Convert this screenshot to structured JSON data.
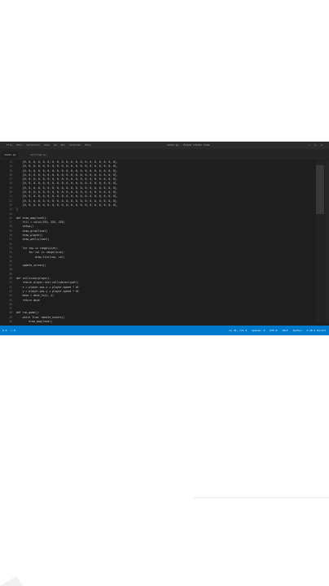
{
  "window": {
    "menu": [
      "File",
      "Edit",
      "Selection",
      "View",
      "Go",
      "Run",
      "Terminal",
      "Help"
    ],
    "title": "level.py - Visual Studio Code",
    "controls": [
      "—",
      "□",
      "✕"
    ]
  },
  "tabs": [
    {
      "label": "level.py"
    },
    {
      "label": "settings.py"
    }
  ],
  "code_lines": [
    {
      "n": "13",
      "t": "    [0, 0, 0, 0, 0, 0, 0, 0, 0, 0, 0, 0, 0, 0, 0, 0, 0, 0, 0, 0],"
    },
    {
      "n": "14",
      "t": "    [0, 0, 0, 0, 0, 0, 0, 0, 0, 0, 0, 0, 0, 0, 0, 0, 0, 0, 0, 0],"
    },
    {
      "n": "15",
      "t": "    [0, 0, 0, 0, 0, 0, 0, 0, 0, 0, 0, 0, 0, 0, 0, 0, 0, 0, 0, 0],"
    },
    {
      "n": "16",
      "t": "    [0, 0, 0, 0, 0, 0, 0, 0, 0, 0, 0, 0, 0, 0, 0, 0, 0, 0, 0, 0],"
    },
    {
      "n": "17",
      "t": "    [0, 0, 0, 0, 0, 0, 0, 0, 0, 0, 0, 0, 0, 0, 0, 0, 0, 0, 0, 0],"
    },
    {
      "n": "18",
      "t": "    [0, 0, 0, 0, 0, 0, 0, 0, 0, 0, 0, 0, 0, 0, 0, 0, 0, 0, 0, 0],"
    },
    {
      "n": "19",
      "t": "    [0, 0, 0, 0, 0, 0, 0, 0, 0, 0, 0, 0, 0, 0, 0, 0, 0, 0, 0, 0],"
    },
    {
      "n": "20",
      "t": "    [0, 0, 0, 0, 0, 0, 0, 0, 0, 0, 0, 0, 0, 0, 0, 0, 0, 0, 0, 0],"
    },
    {
      "n": "21",
      "t": "    [0, 0, 0, 0, 0, 0, 0, 0, 0, 0, 0, 0, 0, 0, 0, 0, 0, 0, 0, 0],"
    },
    {
      "n": "22",
      "t": "    [0, 0, 0, 0, 0, 0, 0, 0, 0, 0, 0, 0, 0, 0, 0, 0, 0, 0, 0, 0],"
    },
    {
      "n": "23",
      "t": "    [0, 0, 0, 0, 0, 0, 0, 0, 0, 0, 0, 0, 0, 0, 0, 0, 0, 0, 0, 0],"
    },
    {
      "n": "24",
      "t": "]"
    },
    {
      "n": "25",
      "t": ""
    },
    {
      "n": "26",
      "t": "def draw_map(level):"
    },
    {
      "n": "27",
      "t": "    fill = color(255, 255, 255)"
    },
    {
      "n": "28",
      "t": "    setup()"
    },
    {
      "n": "29",
      "t": "    draw_grid(level)"
    },
    {
      "n": "30",
      "t": "    draw_player()"
    },
    {
      "n": "31",
      "t": "    draw_walls(level)"
    },
    {
      "n": "32",
      "t": ""
    },
    {
      "n": "33",
      "t": "    for row in range(size):"
    },
    {
      "n": "34",
      "t": "        for col in range(size):"
    },
    {
      "n": "35",
      "t": "            draw_tile(row, col)"
    },
    {
      "n": "36",
      "t": ""
    },
    {
      "n": "37",
      "t": "    update_screen()"
    },
    {
      "n": "38",
      "t": ""
    },
    {
      "n": "39",
      "t": ""
    },
    {
      "n": "40",
      "t": "def collision(player):"
    },
    {
      "n": "41",
      "t": "    return player.rect.colliderect(wall)"
    },
    {
      "n": "42",
      "t": "    x = player.pos.x + player.speed * dt"
    },
    {
      "n": "43",
      "t": "    y = player.pos.y + player.speed * dt"
    },
    {
      "n": "44",
      "t": "    move = move_to(x, y)"
    },
    {
      "n": "45",
      "t": "    return move"
    },
    {
      "n": "46",
      "t": ""
    },
    {
      "n": "47",
      "t": ""
    },
    {
      "n": "48",
      "t": "def run_game():"
    },
    {
      "n": "49",
      "t": "    while True: handle_events()"
    },
    {
      "n": "50",
      "t": "        draw_map(level)"
    }
  ],
  "statusbar": {
    "left": [
      "⊗ 0",
      "⚠ 0"
    ],
    "right": [
      "Ln 24, Col 2",
      "Spaces: 4",
      "UTF-8",
      "CRLF",
      "Python",
      "3.10.4 64-bit"
    ]
  },
  "colors": {
    "editor_bg": "#1e1e1e",
    "status_bar": "#007acc"
  }
}
